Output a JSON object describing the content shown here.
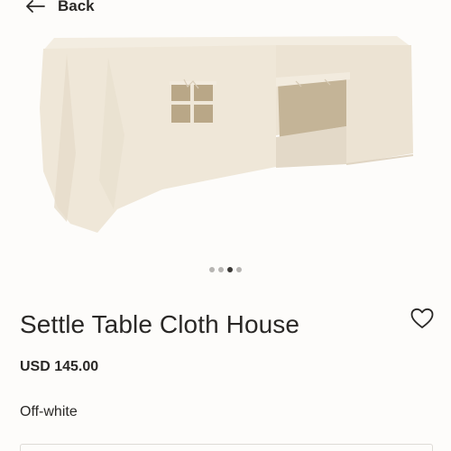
{
  "nav": {
    "back_label": "Back",
    "back_icon": "arrow-left-icon"
  },
  "gallery": {
    "image_alt": "Settle Table Cloth House",
    "total_images": 4,
    "active_index": 2
  },
  "product": {
    "title": "Settle Table Cloth House",
    "price": "USD 145.00",
    "color": "Off-white",
    "wishlist_icon": "heart-outline-icon"
  },
  "colors": {
    "text": "#2a2826",
    "cloth": "#efe7d8",
    "window": "#b9a787",
    "background": "#fdfcfa"
  }
}
